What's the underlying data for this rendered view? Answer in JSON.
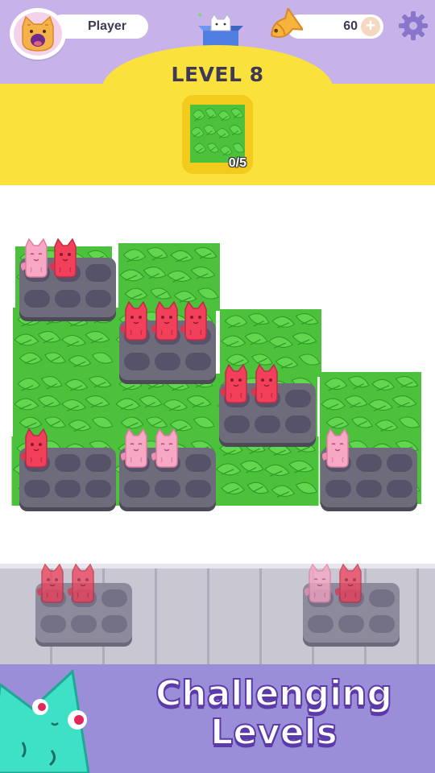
{
  "header": {
    "player_name": "Player",
    "coins": "60",
    "add_coins_label": "+"
  },
  "level": {
    "title": "LEVEL 8",
    "goal_progress": "0/5"
  },
  "promo": {
    "line1": "Challenging",
    "line2": "Levels"
  },
  "colors": {
    "topbar": "#c7b3ea",
    "banner": "#fbe13c",
    "bush": "#4cc13c",
    "platform": "#6e6b7b",
    "cat_red": "#f2405a",
    "cat_pink": "#f7a8c4",
    "promo_text_outline": "#5c3aa8",
    "mascot": "#3ee0c6"
  },
  "board": {
    "platforms": [
      {
        "cats": [
          "pink",
          "red"
        ]
      },
      {
        "cats": [
          "red",
          "red",
          "red"
        ]
      },
      {
        "cats": [
          "red",
          "red"
        ]
      },
      {
        "cats": [
          "red"
        ]
      },
      {
        "cats": [
          "pink",
          "pink"
        ]
      },
      {
        "cats": [
          "pink"
        ]
      }
    ]
  },
  "dock": {
    "platforms": [
      {
        "cats": [
          "red",
          "red"
        ]
      },
      {
        "cats": [
          "pink",
          "red"
        ]
      }
    ]
  }
}
